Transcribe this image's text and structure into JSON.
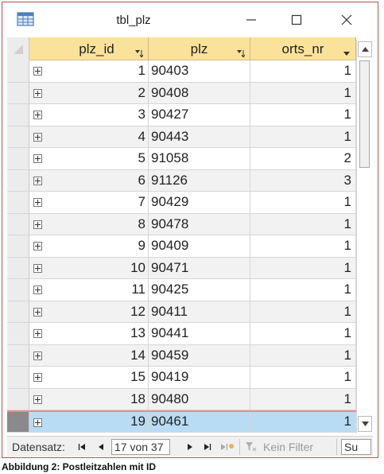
{
  "window": {
    "title": "tbl_plz"
  },
  "columns": [
    {
      "label": "plz_id",
      "icon": "filter-sort-icon"
    },
    {
      "label": "plz",
      "icon": "filter-sort-icon"
    },
    {
      "label": "orts_nr",
      "icon": "dropdown-arrow-icon"
    }
  ],
  "rows": [
    {
      "plz_id": "1",
      "plz": "90403",
      "orts_nr": "1"
    },
    {
      "plz_id": "2",
      "plz": "90408",
      "orts_nr": "1"
    },
    {
      "plz_id": "3",
      "plz": "90427",
      "orts_nr": "1"
    },
    {
      "plz_id": "4",
      "plz": "90443",
      "orts_nr": "1"
    },
    {
      "plz_id": "5",
      "plz": "91058",
      "orts_nr": "2"
    },
    {
      "plz_id": "6",
      "plz": "91126",
      "orts_nr": "3"
    },
    {
      "plz_id": "7",
      "plz": "90429",
      "orts_nr": "1"
    },
    {
      "plz_id": "8",
      "plz": "90478",
      "orts_nr": "1"
    },
    {
      "plz_id": "9",
      "plz": "90409",
      "orts_nr": "1"
    },
    {
      "plz_id": "10",
      "plz": "90471",
      "orts_nr": "1"
    },
    {
      "plz_id": "11",
      "plz": "90425",
      "orts_nr": "1"
    },
    {
      "plz_id": "12",
      "plz": "90411",
      "orts_nr": "1"
    },
    {
      "plz_id": "13",
      "plz": "90441",
      "orts_nr": "1"
    },
    {
      "plz_id": "14",
      "plz": "90459",
      "orts_nr": "1"
    },
    {
      "plz_id": "15",
      "plz": "90419",
      "orts_nr": "1"
    },
    {
      "plz_id": "18",
      "plz": "90480",
      "orts_nr": "1"
    },
    {
      "plz_id": "19",
      "plz": "90461",
      "orts_nr": "1"
    }
  ],
  "selected_row": 16,
  "navbar": {
    "label": "Datensatz:",
    "position": "17 von 37",
    "filter_label": "Kein Filter",
    "search_value": "Su"
  },
  "caption": "Abbildung 2: Postleitzahlen mit ID",
  "colors": {
    "header_bg": "#fbe29a",
    "selected_bg": "#b9dcf5",
    "window_border": "#c0504d"
  }
}
